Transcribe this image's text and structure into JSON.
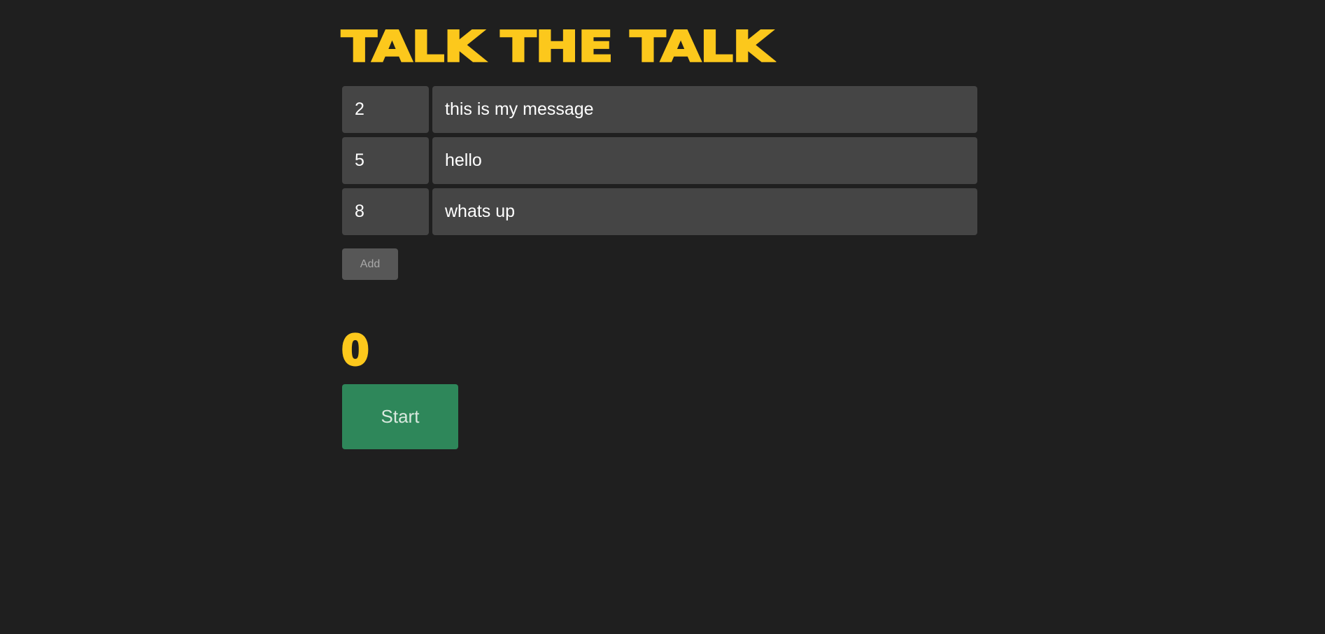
{
  "header": {
    "title": "Talk the Talk"
  },
  "messages": [
    {
      "time": "2",
      "text": "this is my message"
    },
    {
      "time": "5",
      "text": "hello"
    },
    {
      "time": "8",
      "text": "whats up"
    }
  ],
  "controls": {
    "add_label": "Add",
    "start_label": "Start"
  },
  "timer": {
    "value": "0"
  },
  "colors": {
    "background": "#1f1f1f",
    "accent": "#fcc81c",
    "field": "#454545",
    "add_button": "#575757",
    "start_button": "#2e875a"
  }
}
